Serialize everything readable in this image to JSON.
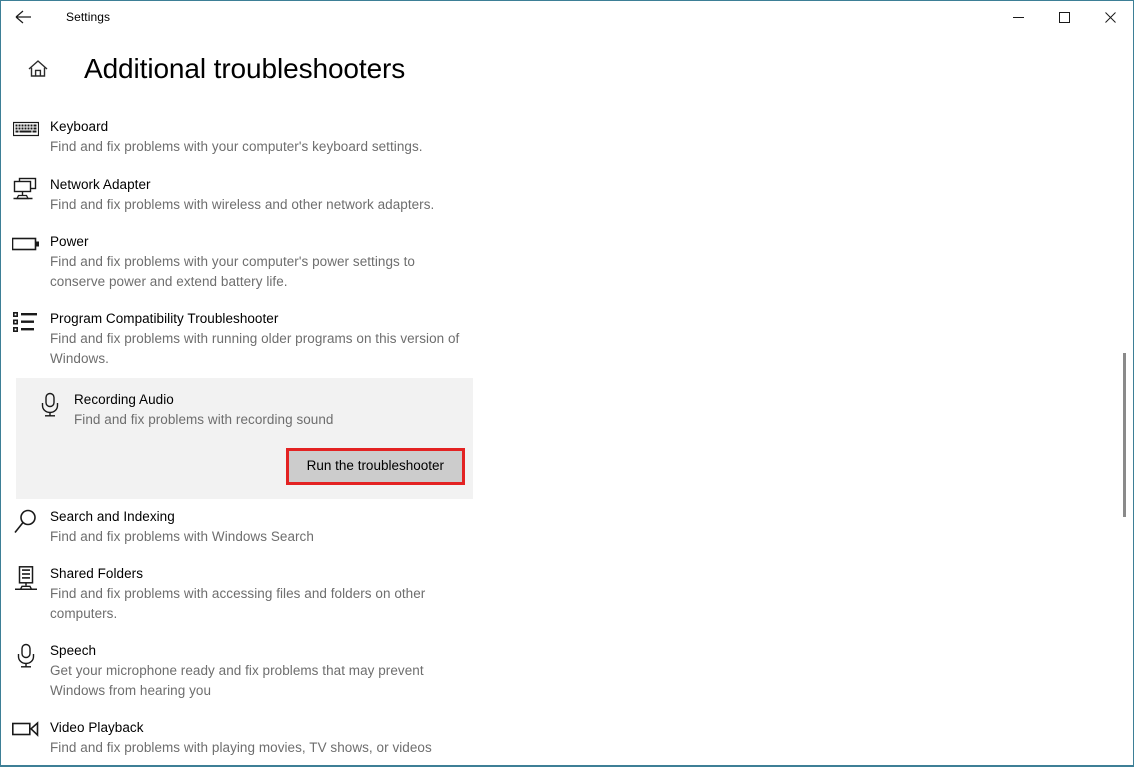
{
  "window": {
    "app_title": "Settings",
    "border_color": "#3d7f96",
    "back_icon": "back-arrow-icon",
    "minimize_label": "─",
    "maximize_label": "□",
    "close_label": "✕"
  },
  "header": {
    "home_icon": "home-icon",
    "page_title": "Additional troubleshooters"
  },
  "list": {
    "items": [
      {
        "icon": "keyboard-icon",
        "title": "Keyboard",
        "desc": "Find and fix problems with your computer's keyboard settings.",
        "highlighted": false
      },
      {
        "icon": "network-adapter-icon",
        "title": "Network Adapter",
        "desc": "Find and fix problems with wireless and other network adapters.",
        "highlighted": false
      },
      {
        "icon": "battery-icon",
        "title": "Power",
        "desc": "Find and fix problems with your computer's power settings to conserve power and extend battery life.",
        "highlighted": false
      },
      {
        "icon": "program-list-icon",
        "title": "Program Compatibility Troubleshooter",
        "desc": "Find and fix problems with running older programs on this version of Windows.",
        "highlighted": false
      },
      {
        "icon": "microphone-icon",
        "title": "Recording Audio",
        "desc": "Find and fix problems with recording sound",
        "highlighted": true,
        "button_label": "Run the troubleshooter"
      },
      {
        "icon": "magnifier-icon",
        "title": "Search and Indexing",
        "desc": "Find and fix problems with Windows Search",
        "highlighted": false
      },
      {
        "icon": "shared-folders-icon",
        "title": "Shared Folders",
        "desc": "Find and fix problems with accessing files and folders on other computers.",
        "highlighted": false
      },
      {
        "icon": "microphone-icon",
        "title": "Speech",
        "desc": "Get your microphone ready and fix problems that may prevent Windows from hearing you",
        "highlighted": false
      },
      {
        "icon": "video-camera-icon",
        "title": "Video Playback",
        "desc": "Find and fix problems with playing movies, TV shows, or videos",
        "highlighted": false
      }
    ]
  },
  "colors": {
    "highlight_background": "#f2f2f2",
    "button_background": "#cccccc",
    "button_outline": "#e32222",
    "description_text": "#6e6e6e",
    "scrollbar_thumb": "#8a8a8a"
  }
}
